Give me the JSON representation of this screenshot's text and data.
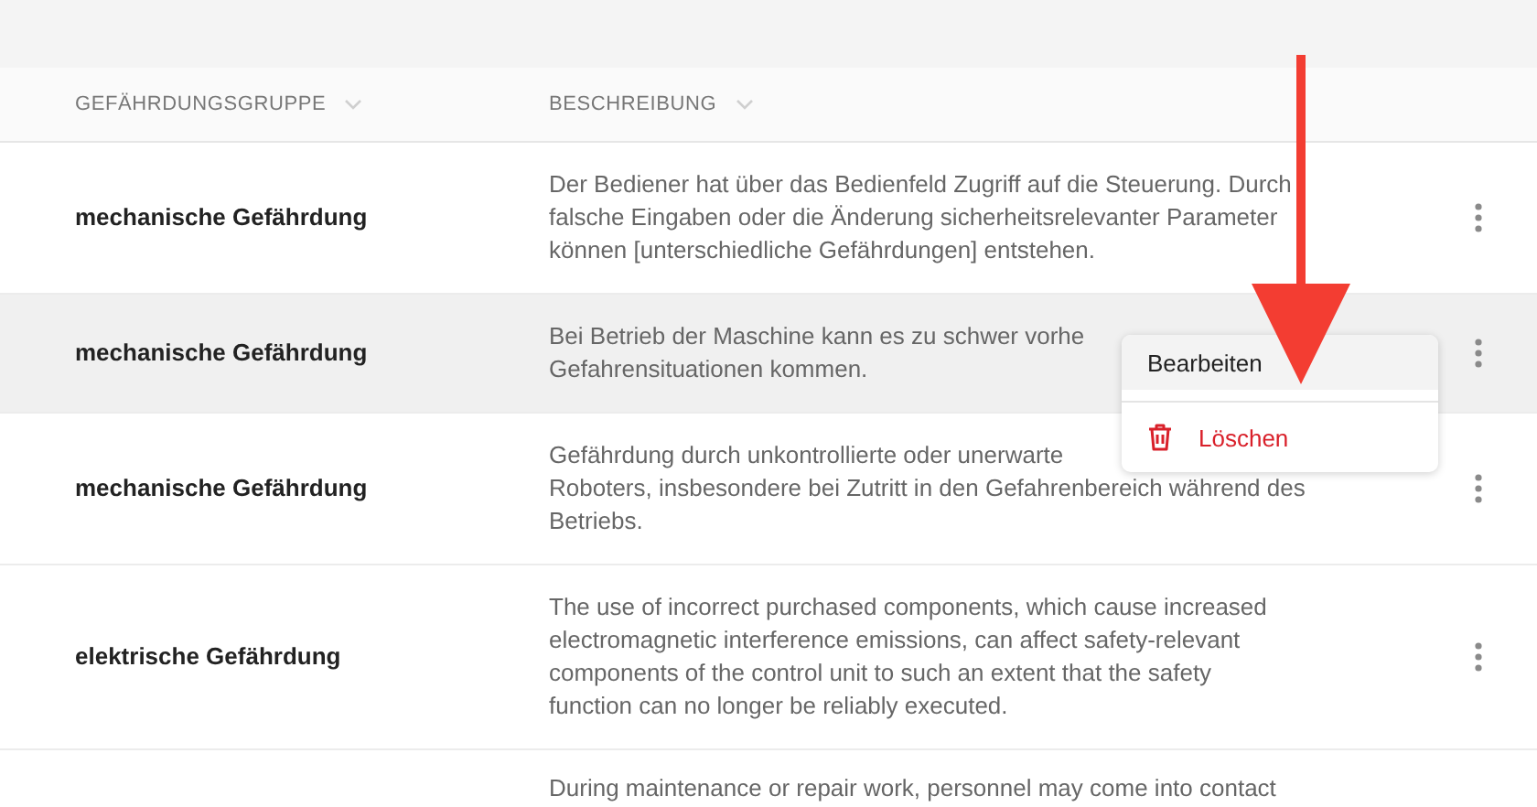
{
  "table": {
    "columns": [
      {
        "label": "GEFÄHRDUNGSGRUPPE"
      },
      {
        "label": "BESCHREIBUNG"
      }
    ],
    "rows": [
      {
        "group": "mechanische Gefährdung",
        "description": "Der Bediener hat über das Bedienfeld Zugriff auf die Steuerung. Durch\nfalsche Eingaben oder die Änderung sicherheitsrelevanter Parameter\nkönnen [unterschiedliche Gefährdungen] entstehen.",
        "selected": false
      },
      {
        "group": "mechanische Gefährdung",
        "description": "Bei Betrieb der Maschine kann es zu schwer vorhe\nGefahrensituationen kommen.",
        "selected": true
      },
      {
        "group": "mechanische Gefährdung",
        "description": "Gefährdung durch unkontrollierte oder unerwarte\nRoboters, insbesondere bei Zutritt in den Gefahrenbereich während des\nBetriebs.",
        "selected": false
      },
      {
        "group": "elektrische Gefährdung",
        "description": "The use of incorrect purchased components, which cause increased\nelectromagnetic interference emissions, can affect safety-relevant\ncomponents of the control unit to such an extent that the safety\nfunction can no longer be reliably executed.",
        "selected": false
      },
      {
        "description": "During maintenance or repair work, personnel may come into contact",
        "selected": false
      }
    ]
  },
  "context_menu": {
    "items": [
      {
        "label": "Bearbeiten",
        "kind": "edit",
        "selected": true
      },
      {
        "label": "Löschen",
        "kind": "delete",
        "selected": false
      }
    ]
  }
}
